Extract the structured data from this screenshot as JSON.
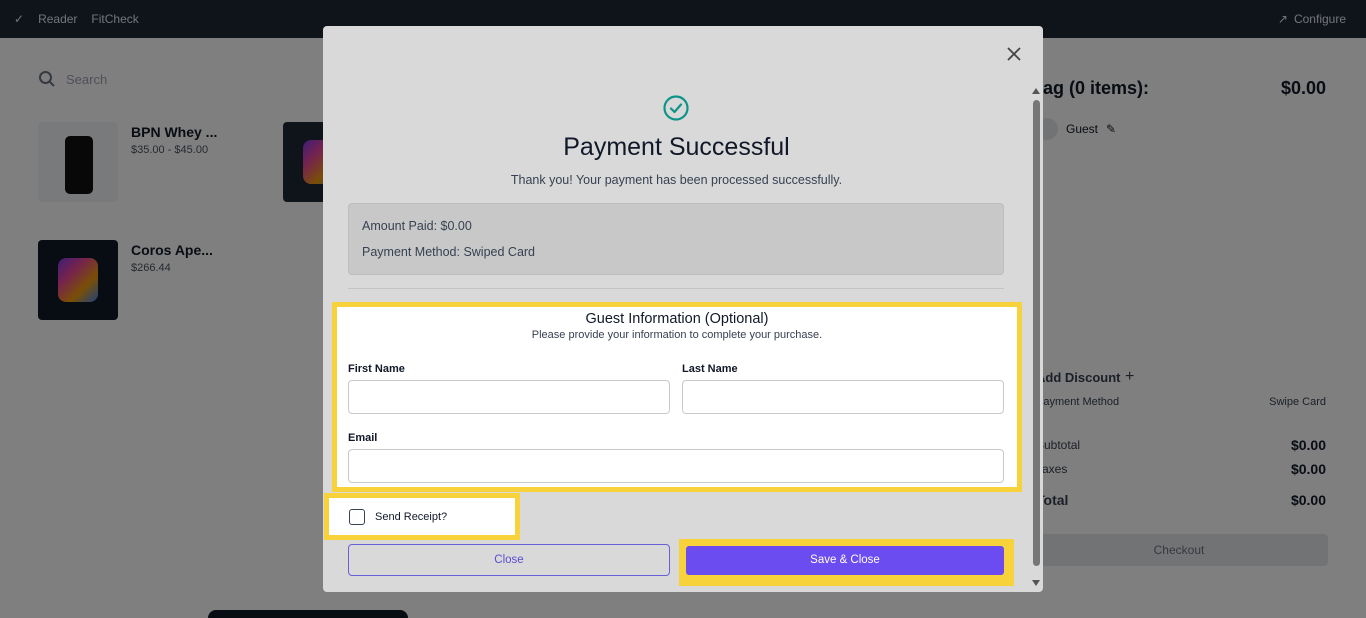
{
  "topbar": {
    "reader_label": "Reader",
    "app_name": "FitCheck",
    "configure_label": "Configure"
  },
  "catalog": {
    "search_placeholder": "Search",
    "products": [
      {
        "name": "BPN Whey ...",
        "price": "$35.00 - $45.00"
      },
      {
        "name": "",
        "price": ""
      },
      {
        "name": "Coros Ape...",
        "price": "$266.44"
      }
    ]
  },
  "bag": {
    "title": "Bag (0 items):",
    "total": "$0.00",
    "guest_label": "Guest",
    "add_discount": "Add Discount",
    "payment_method_label": "Payment Method",
    "payment_method_value": "Swipe Card",
    "subtotal_label": "Subtotal",
    "subtotal_value": "$0.00",
    "taxes_label": "Taxes",
    "taxes_value": "$0.00",
    "grand_total_label": "Total",
    "grand_total_value": "$0.00",
    "checkout_label": "Checkout"
  },
  "modal": {
    "title": "Payment Successful",
    "subtitle": "Thank you! Your payment has been processed successfully.",
    "amount_paid": "Amount Paid:  $0.00",
    "payment_method": "Payment Method:  Swiped Card",
    "guest_info": {
      "title": "Guest Information (Optional)",
      "subtitle": "Please provide your information to complete your purchase.",
      "first_name_label": "First Name",
      "last_name_label": "Last Name",
      "email_label": "Email",
      "first_name_value": "",
      "last_name_value": "",
      "email_value": ""
    },
    "send_receipt_label": "Send Receipt?",
    "close_button": "Close",
    "save_button": "Save & Close"
  },
  "colors": {
    "accent": "#6a4cf0",
    "highlight": "#f8d23a",
    "success": "#0d9488"
  }
}
